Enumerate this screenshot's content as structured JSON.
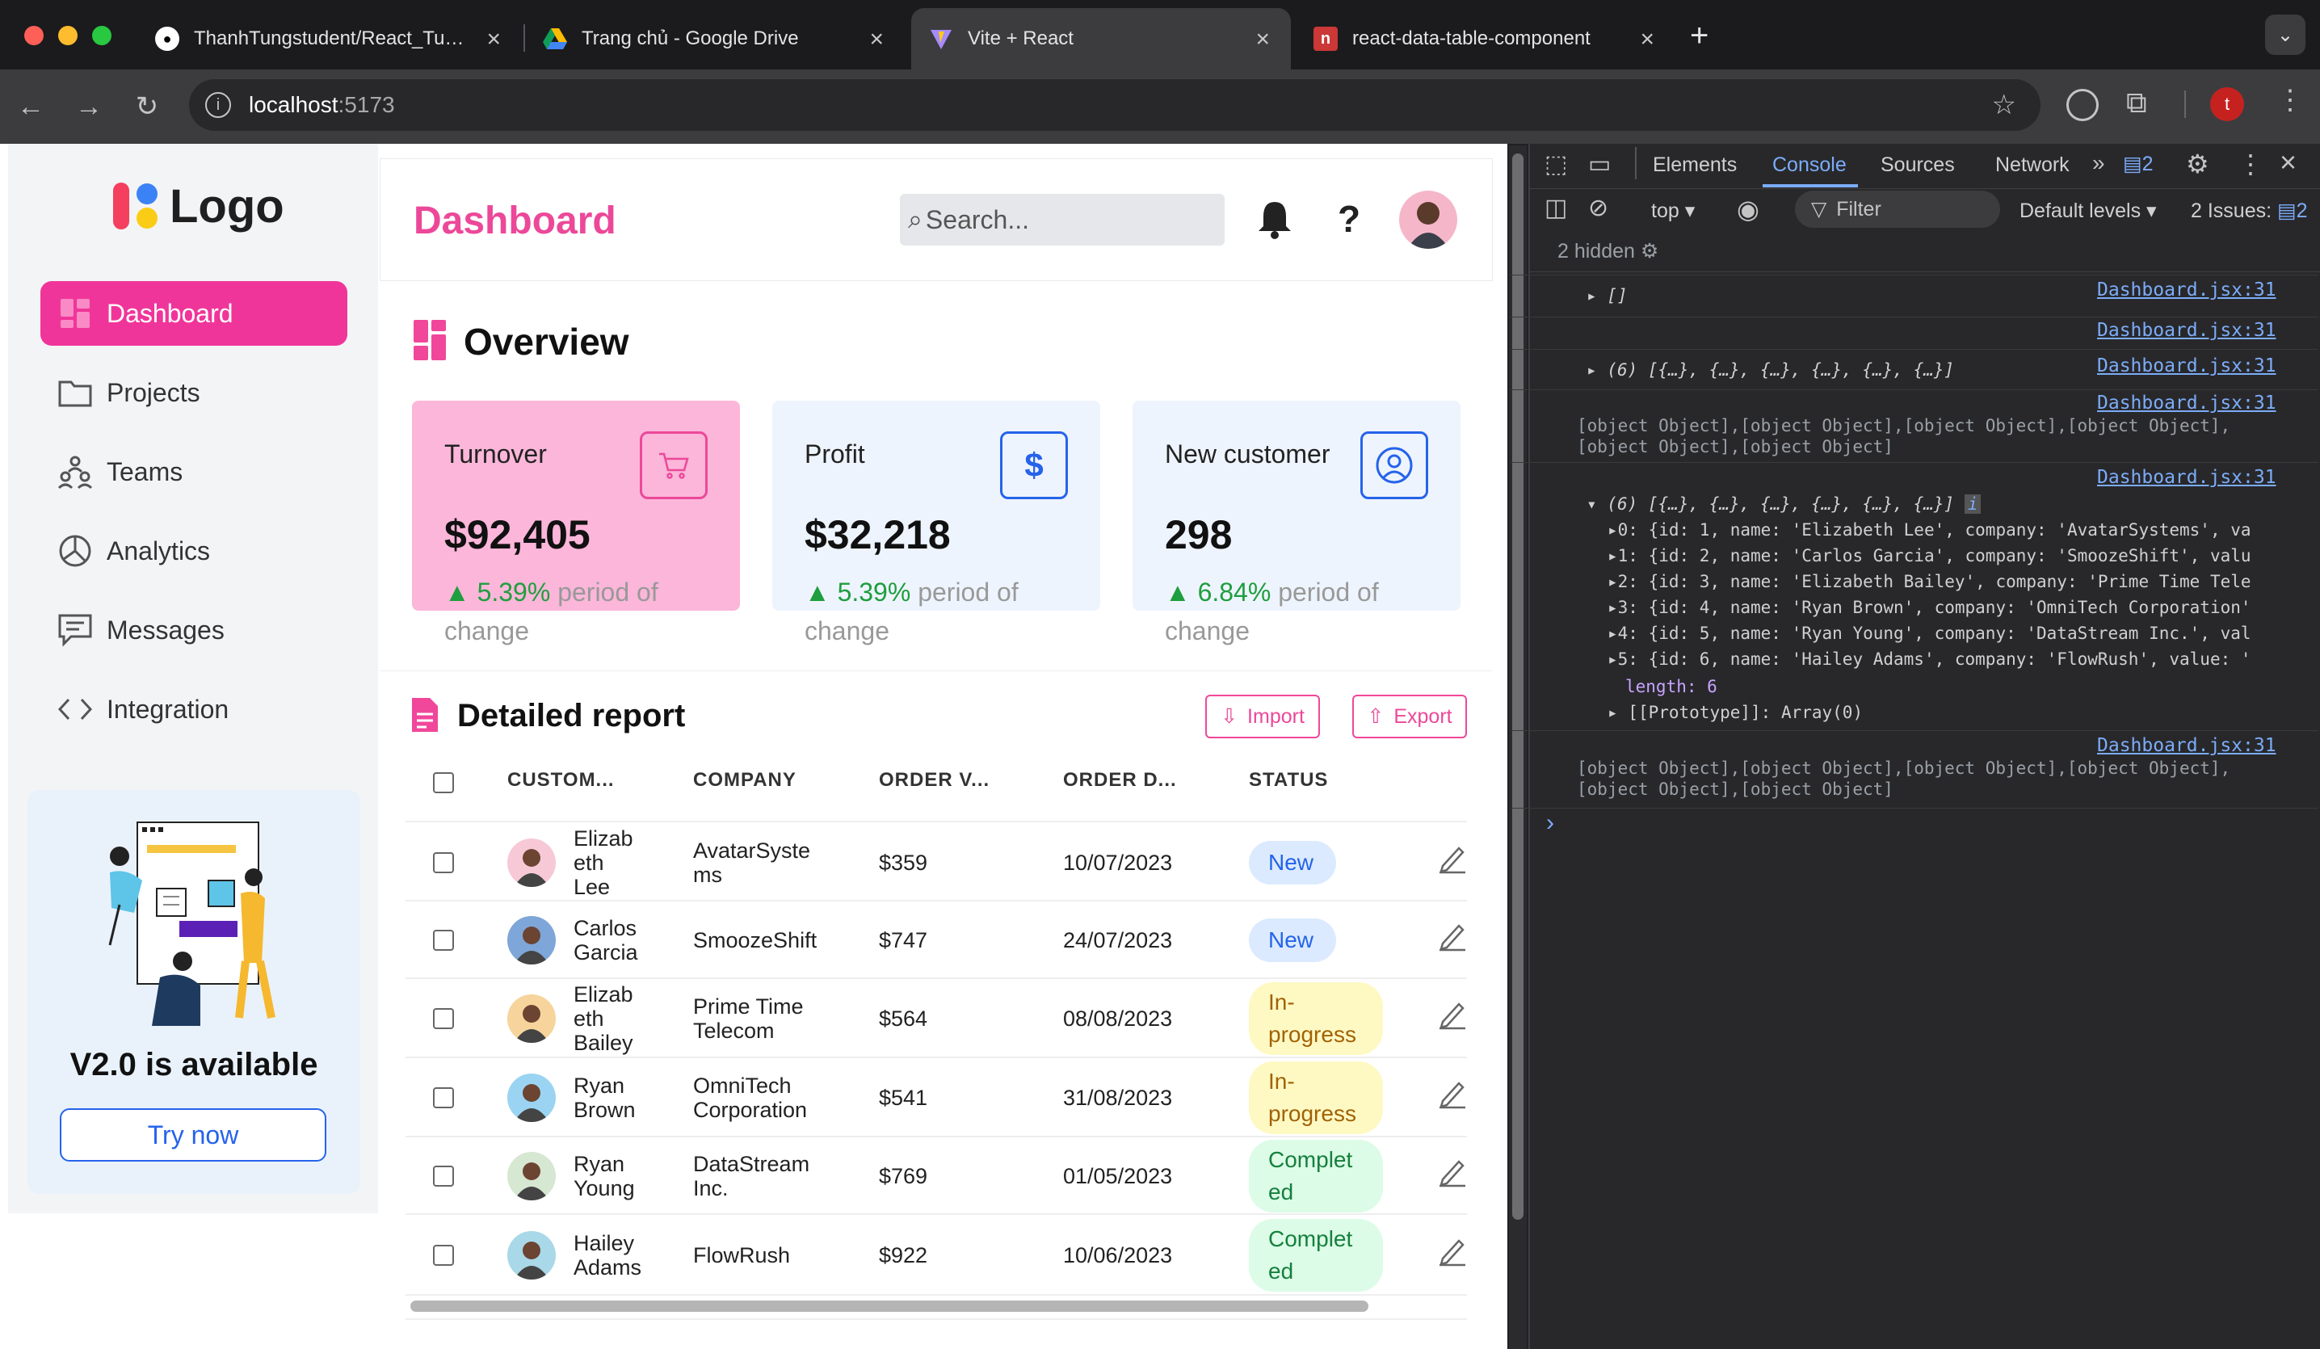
{
  "browser": {
    "tabs": [
      {
        "title": "ThanhTungstudent/React_Tu…",
        "icon": "github-icon"
      },
      {
        "title": "Trang chủ - Google Drive",
        "icon": "google-drive-icon"
      },
      {
        "title": "Vite + React",
        "icon": "vite-icon"
      },
      {
        "title": "react-data-table-component",
        "icon": "npm-icon"
      }
    ],
    "url_host": "localhost",
    "url_port": ":5173",
    "profile_initial": "t"
  },
  "app": {
    "logo": "Logo",
    "nav": [
      {
        "label": "Dashboard",
        "icon": "grid-icon",
        "active": true
      },
      {
        "label": "Projects",
        "icon": "folder-icon"
      },
      {
        "label": "Teams",
        "icon": "teams-icon"
      },
      {
        "label": "Analytics",
        "icon": "pie-chart-icon"
      },
      {
        "label": "Messages",
        "icon": "message-icon"
      },
      {
        "label": "Integration",
        "icon": "code-icon"
      }
    ],
    "promo": {
      "title": "V2.0 is available",
      "button": "Try now"
    },
    "header": {
      "title": "Dashboard",
      "search_placeholder": "Search..."
    },
    "overview": {
      "title": "Overview",
      "cards": [
        {
          "label": "Turnover",
          "value": "$92,405",
          "change": "5.39%",
          "suffix": "period of change",
          "icon": "cart-icon",
          "bg": "#fbb6d9",
          "accent": "#ec4899"
        },
        {
          "label": "Profit",
          "value": "$32,218",
          "change": "5.39%",
          "suffix": "period of change",
          "icon": "dollar-icon",
          "bg": "#eef4fd",
          "accent": "#2563eb"
        },
        {
          "label": "New customer",
          "value": "298",
          "change": "6.84%",
          "suffix": "period of change",
          "icon": "user-circle-icon",
          "bg": "#eef4fd",
          "accent": "#2563eb"
        }
      ]
    },
    "report": {
      "title": "Detailed report",
      "import": "Import",
      "export": "Export",
      "columns": [
        "CUSTOM...",
        "COMPANY",
        "ORDER V...",
        "ORDER D...",
        "STATUS"
      ],
      "rows": [
        {
          "name": "Elizab\neth\nLee",
          "company": "AvatarSyste\nms",
          "value": "$359",
          "date": "10/07/2023",
          "status": "New"
        },
        {
          "name": "Carlos\nGarcia",
          "company": "SmoozeShift",
          "value": "$747",
          "date": "24/07/2023",
          "status": "New"
        },
        {
          "name": "Elizab\neth\nBailey",
          "company": "Prime Time\nTelecom",
          "value": "$564",
          "date": "08/08/2023",
          "status": "In-\nprogress"
        },
        {
          "name": "Ryan\nBrown",
          "company": "OmniTech\nCorporation",
          "value": "$541",
          "date": "31/08/2023",
          "status": "In-\nprogress"
        },
        {
          "name": "Ryan\nYoung",
          "company": "DataStream\nInc.",
          "value": "$769",
          "date": "01/05/2023",
          "status": "Complet\ned"
        },
        {
          "name": "Hailey\nAdams",
          "company": "FlowRush",
          "value": "$922",
          "date": "10/06/2023",
          "status": "Complet\ned"
        }
      ],
      "status_colors": {
        "New": "#dbeafe",
        "In-\nprogress": "#fef9c3",
        "Complet\ned": "#dcfce7"
      },
      "status_text": {
        "New": "#2563eb",
        "In-\nprogress": "#a16207",
        "Complet\ned": "#15803d"
      }
    }
  },
  "devtools": {
    "tabs": [
      "Elements",
      "Console",
      "Sources",
      "Network"
    ],
    "msg_count": "2",
    "context": "top",
    "filter": "Filter",
    "levels": "Default levels",
    "issues": "2 Issues:",
    "issues_count": "2",
    "hidden": "2 hidden",
    "source": "Dashboard.jsx:31",
    "log_empty": "[]",
    "log_array": "(6) [{…}, {…}, {…}, {…}, {…}, {…}]",
    "log_objects": "[object Object],[object Object],[object Object],[object Object],\n[object Object],[object Object]",
    "entries": [
      "0: {id: 1, name: 'Elizabeth Lee', company: 'AvatarSystems', va",
      "1: {id: 2, name: 'Carlos Garcia', company: 'SmoozeShift', valu",
      "2: {id: 3, name: 'Elizabeth Bailey', company: 'Prime Time Tele",
      "3: {id: 4, name: 'Ryan Brown', company: 'OmniTech Corporation'",
      "4: {id: 5, name: 'Ryan Young', company: 'DataStream Inc.', val",
      "5: {id: 6, name: 'Hailey Adams', company: 'FlowRush', value: '"
    ],
    "length": "length: 6",
    "prototype": "[[Prototype]]: Array(0)"
  }
}
